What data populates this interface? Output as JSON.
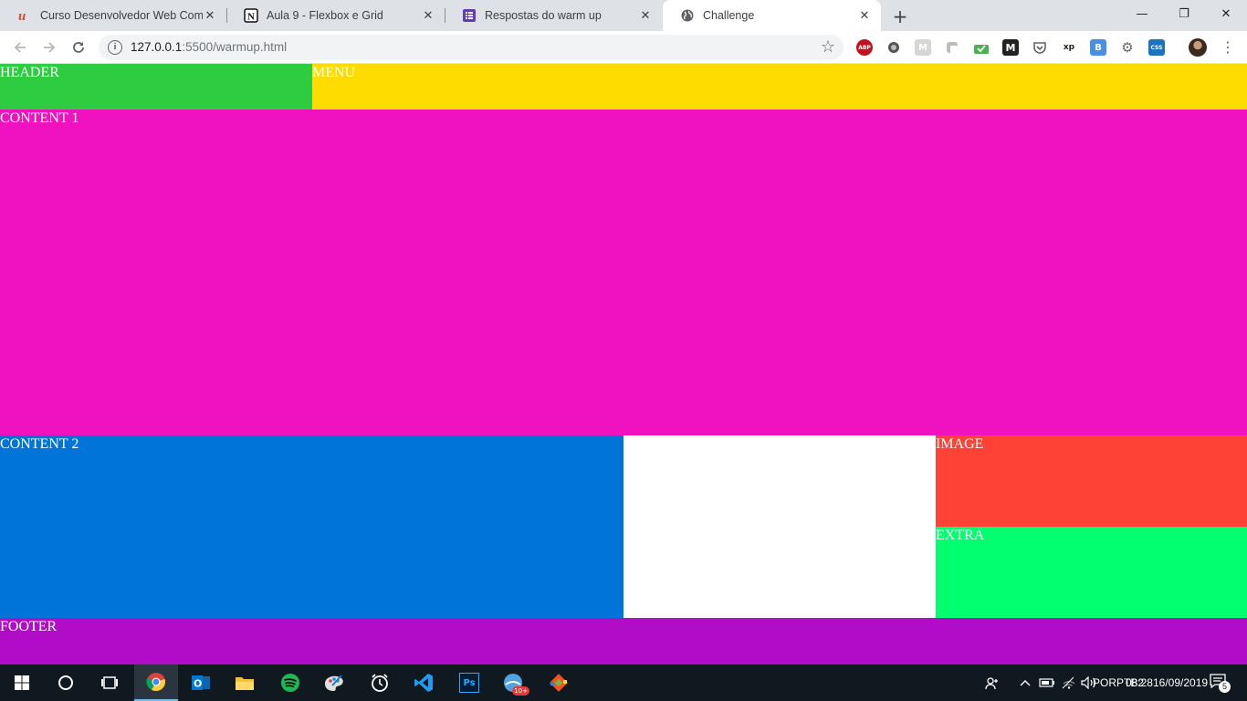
{
  "browser": {
    "tabs": [
      {
        "title": "Curso Desenvolvedor Web Comp",
        "icon": "u-logo-icon",
        "active": false
      },
      {
        "title": "Aula 9 - Flexbox e Grid",
        "icon": "notion-icon",
        "active": false
      },
      {
        "title": "Respostas do warm up",
        "icon": "form-icon",
        "active": false
      },
      {
        "title": "Challenge",
        "icon": "globe-icon",
        "active": true
      }
    ],
    "new_tab_glyph": "+",
    "window_controls": {
      "minimize": "—",
      "restore": "❐",
      "close": "✕"
    },
    "url": {
      "host": "127.0.0.1",
      "rest": ":5500/warmup.html"
    },
    "extensions": [
      "abp-icon",
      "circle-extension-icon",
      "m-extension-icon",
      "clipboard-extension-icon",
      "bookmark-extension-icon",
      "medium-icon",
      "pocket-icon",
      "xp-icon",
      "b-extension-icon",
      "gear-extension-icon",
      "css-viewer-icon"
    ],
    "abp_label": "ABP",
    "xp_label": "xp",
    "css_label": "CSS"
  },
  "page": {
    "header": "HEADER",
    "menu": "MENU",
    "content1": "CONTENT 1",
    "content2": "CONTENT 2",
    "image": "IMAGE",
    "extra": "EXTRA",
    "footer": "FOOTER",
    "colors": {
      "header": "#2ecc40",
      "menu": "#ffdc00",
      "content1": "#f012be",
      "content2": "#0074d9",
      "image": "#ff4136",
      "extra": "#01ff70",
      "footer": "#b10dc9"
    }
  },
  "taskbar": {
    "apps": [
      "windows-start-icon",
      "cortana-icon",
      "task-view-icon",
      "chrome-icon",
      "outlook-icon",
      "file-explorer-icon",
      "spotify-icon",
      "paint-icon",
      "alarms-icon",
      "vscode-icon",
      "photoshop-icon",
      "browser-badge-icon",
      "git-icon"
    ],
    "ps_label": "Ps",
    "badge_label": "10+",
    "language": {
      "line1": "POR",
      "line2": "PTB2"
    },
    "time": "08:28",
    "date": "16/09/2019",
    "notifications": "5"
  }
}
